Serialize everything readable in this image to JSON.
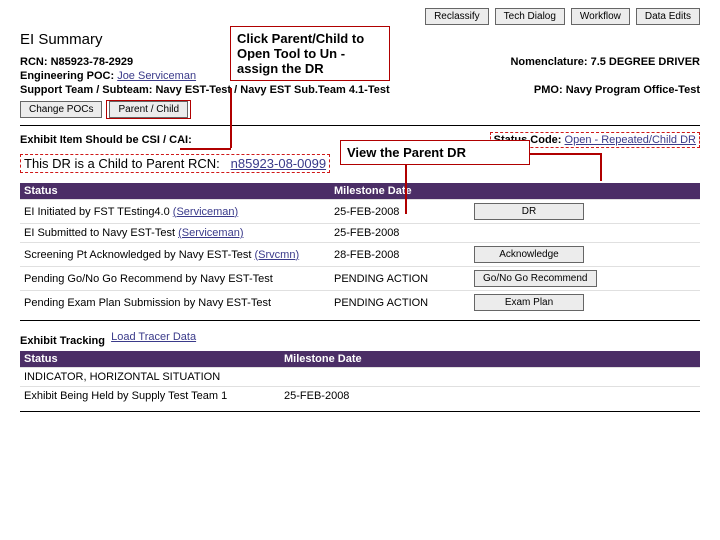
{
  "topButtons": {
    "reclassify": "Reclassify",
    "techDialog": "Tech Dialog",
    "workflow": "Workflow",
    "dataEdits": "Data Edits"
  },
  "callouts": {
    "parentChild": "Click Parent/Child to Open Tool to Un -assign the DR",
    "viewParent": "View the Parent DR"
  },
  "summary": {
    "title": "EI Summary",
    "rcnLabel": "RCN:",
    "rcn": "N85923-78-2929",
    "nomLabel": "Nomenclature:",
    "nom": "7.5 DEGREE DRIVER",
    "engPocLabel": "Engineering POC:",
    "engPoc": "Joe Serviceman",
    "supportLabel": "Support Team / Subteam:",
    "support": "Navy EST-Test / Navy EST Sub.Team 4.1-Test",
    "pmoLabel": "PMO:",
    "pmo": "Navy Program Office-Test",
    "changePocs": "Change POCs",
    "parentChild": "Parent / Child"
  },
  "exhibitItem": {
    "label": "Exhibit Item Should be CSI / CAI:"
  },
  "statusCode": {
    "label": "Status Code:",
    "value": "Open - Repeated/Child DR"
  },
  "childLine": {
    "text": "This DR is a Child to Parent RCN:",
    "rcn": "n85923-08-0099"
  },
  "statusTable": {
    "headStatus": "Status",
    "headDate": "Milestone Date",
    "rows": [
      {
        "status": "EI Initiated by FST TEsting4.0",
        "link": "(Serviceman)",
        "date": "25-FEB-2008",
        "btn": "DR"
      },
      {
        "status": "EI Submitted to Navy EST-Test",
        "link": "(Serviceman)",
        "date": "25-FEB-2008",
        "btn": ""
      },
      {
        "status": "Screening Pt Acknowledged by Navy EST-Test",
        "link": "(Srvcmn)",
        "date": "28-FEB-2008",
        "btn": "Acknowledge"
      },
      {
        "status": "Pending Go/No Go Recommend by Navy EST-Test",
        "link": "",
        "date": "PENDING ACTION",
        "btn": "Go/No Go Recommend"
      },
      {
        "status": "Pending Exam Plan Submission by Navy EST-Test",
        "link": "",
        "date": "PENDING ACTION",
        "btn": "Exam Plan"
      }
    ]
  },
  "exhibitTracking": {
    "label": "Exhibit Tracking",
    "link": "Load Tracer Data",
    "headStatus": "Status",
    "headDate": "Milestone Date",
    "rows": [
      {
        "status": "INDICATOR, HORIZONTAL SITUATION",
        "date": ""
      },
      {
        "status": "Exhibit Being Held by Supply Test Team 1",
        "date": "25-FEB-2008"
      }
    ]
  }
}
